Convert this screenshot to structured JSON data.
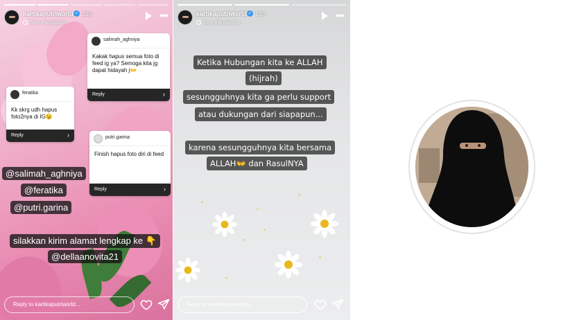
{
  "stories": [
    {
      "username": "kartikaputriworld",
      "time": "21h",
      "translation": "See translation",
      "cards": [
        {
          "name": "salimah_aghniya",
          "text": "Kakak hapus semua foto di feed ig ya? Semoga kita jg dapat hidayah j👐",
          "reply": "Reply"
        },
        {
          "name": "feratika",
          "text": "Kk skrg udh hapus foto2nya di IG😉",
          "reply": "Reply"
        },
        {
          "name": "putri.garina",
          "text": "Finish hapus foto diri di feed",
          "reply": "Reply"
        }
      ],
      "tags": [
        "@salimah_aghniya",
        "@feratika",
        "@putri.garina"
      ],
      "message_lines": [
        "silakkan kirim alamat lengkap ke 👇",
        "@dellaanovita21"
      ],
      "reply_placeholder": "Reply to kartikaputriworld..."
    },
    {
      "username": "kartikaputriworld",
      "time": "14h",
      "translation": "See translation",
      "text_lines": [
        "Ketika Hubungan kita ke ALLAH",
        "(hijrah)",
        "sesungguhnya kita ga perlu support",
        "atau dukungan dari siapapun...",
        "karena sesungguhnya kita bersama",
        "ALLAH👐 dan RasulNYA"
      ],
      "reply_placeholder": "Reply to kartikaputriworld..."
    }
  ],
  "icons": {
    "play": "play-icon",
    "more": "more-icon",
    "heart": "heart-icon",
    "send": "send-icon",
    "verified": "verified-badge-icon",
    "globe": "globe-icon"
  },
  "colors": {
    "story1_bg": "#e98bb2",
    "story2_bg": "#e4e5e6",
    "tag_bg": "#141414",
    "card_reply_bg": "#262626",
    "verified": "#3897f0"
  }
}
